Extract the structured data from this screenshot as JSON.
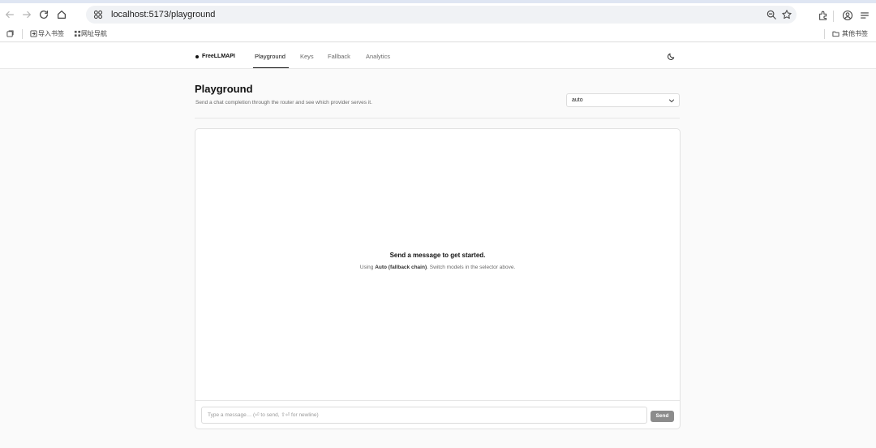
{
  "browser": {
    "url": "localhost:5173/playground",
    "bookmarks": [
      {
        "label": "导入书签",
        "icon": "import-icon"
      },
      {
        "label": "网址导航",
        "icon": "grid-icon"
      }
    ],
    "other_bookmarks": "其他书签",
    "icons": [
      "back-arrow-icon",
      "forward-arrow-icon",
      "reload-icon",
      "home-icon",
      "site-info-icon",
      "zoom-icon",
      "star-icon",
      "extensions-icon",
      "profile-icon",
      "menu-icon",
      "tab-search-icon",
      "folder-icon"
    ]
  },
  "app": {
    "brand": "FreeLLMAPI",
    "nav": [
      "Playground",
      "Keys",
      "Fallback",
      "Analytics"
    ],
    "active_nav": "Playground",
    "theme_toggle_icon": "moon-icon"
  },
  "page": {
    "title": "Playground",
    "subtitle": "Send a chat completion through the router and see which provider serves it.",
    "model_select": {
      "value": "auto"
    }
  },
  "chat": {
    "empty_title": "Send a message to get started.",
    "empty_desc_prefix": "Using ",
    "empty_desc_model": "Auto (fallback chain)",
    "empty_desc_suffix": ". Switch models in the selector above.",
    "input_placeholder": "Type a message… (⏎ to send, ⇧⏎ for newline)",
    "send_label": "Send"
  },
  "colors": {
    "accent": "#111111",
    "send_disabled": "#8c8c8c",
    "omnibox": "#f0f2f5"
  }
}
